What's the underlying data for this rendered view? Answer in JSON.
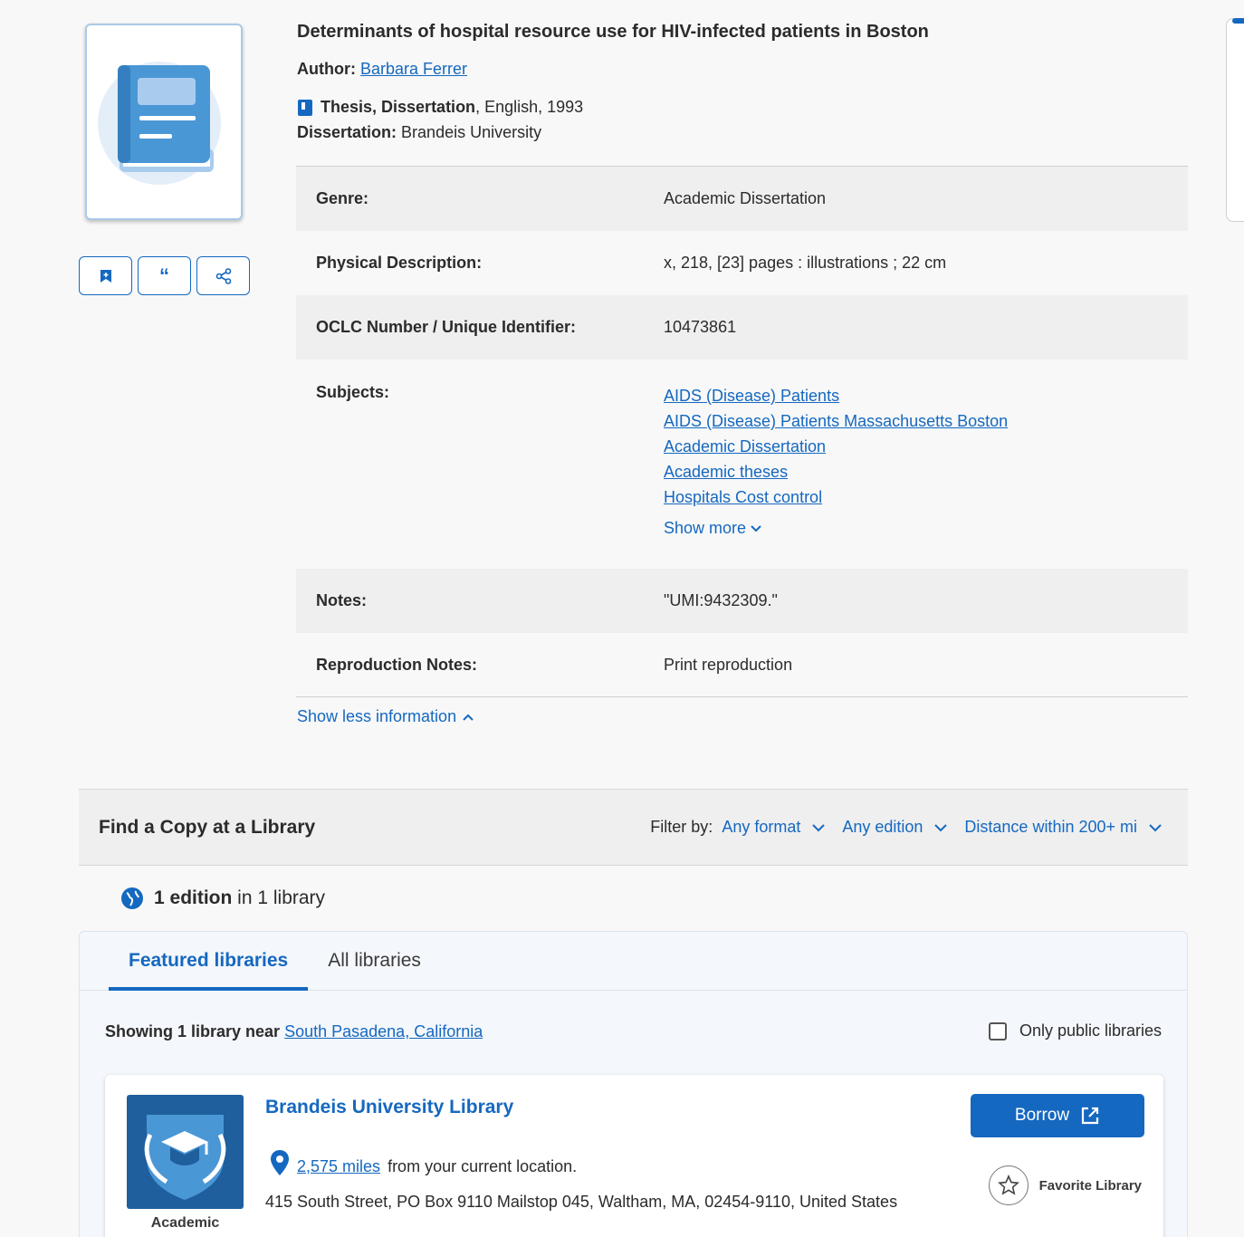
{
  "record": {
    "title": "Determinants of hospital resource use for HIV-infected patients in Boston",
    "author_label": "Author:",
    "author": "Barbara Ferrer",
    "format": "Thesis, Dissertation",
    "language_year": ", English, 1993",
    "dissertation_label": "Dissertation:",
    "dissertation": "Brandeis University"
  },
  "details": {
    "genre_label": "Genre:",
    "genre": "Academic Dissertation",
    "physical_label": "Physical Description:",
    "physical": "x, 218, [23] pages : illustrations ; 22 cm",
    "oclc_label": "OCLC Number / Unique Identifier:",
    "oclc": "10473861",
    "subjects_label": "Subjects:",
    "subjects": [
      "AIDS (Disease) Patients",
      "AIDS (Disease) Patients Massachusetts Boston",
      "Academic Dissertation",
      "Academic theses",
      "Hospitals Cost control"
    ],
    "show_more": "Show more",
    "notes_label": "Notes:",
    "notes": "\"UMI:9432309.\"",
    "repro_label": "Reproduction Notes:",
    "repro": "Print reproduction",
    "show_less": "Show less information"
  },
  "find_copy": {
    "title": "Find a Copy at a Library",
    "filter_label": "Filter by:",
    "filter_format": "Any format",
    "filter_edition": "Any edition",
    "filter_distance": "Distance within 200+ mi",
    "editions_count": "1 edition",
    "editions_rest": " in 1 library",
    "tab_featured": "Featured libraries",
    "tab_all": "All libraries",
    "showing_prefix": "Showing 1 library near",
    "location": "South Pasadena, California",
    "public_only": "Only public libraries"
  },
  "library": {
    "name": "Brandeis University Library",
    "type": "Academic",
    "distance": "2,575 miles",
    "distance_suffix": "from your current location.",
    "address": "415 South Street, PO Box 9110 Mailstop 045, Waltham, MA, 02454-9110, United States",
    "borrow": "Borrow",
    "favorite": "Favorite Library"
  },
  "colors": {
    "accent": "#1568c0",
    "row_shade": "#efefef"
  }
}
